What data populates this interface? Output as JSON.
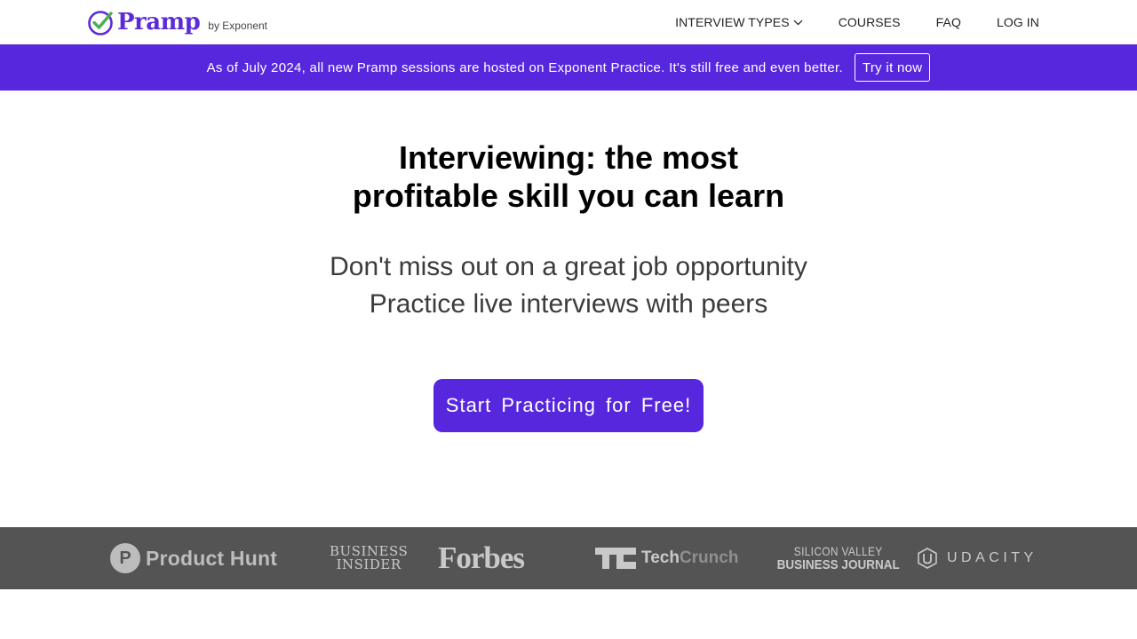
{
  "nav": {
    "logo_text": "Pramp",
    "logo_byline": "by Exponent",
    "links": [
      {
        "label": "INTERVIEW TYPES",
        "has_dropdown": true
      },
      {
        "label": "COURSES"
      },
      {
        "label": "FAQ"
      },
      {
        "label": "LOG IN"
      }
    ]
  },
  "banner": {
    "text": "As of July 2024, all new Pramp sessions are hosted on Exponent Practice. It's still free and even better.",
    "button_label": "Try it now",
    "background": "#5727dd"
  },
  "hero": {
    "title_lines": [
      "Interviewing: the most",
      "profitable skill you can learn"
    ],
    "subtitle_lines": [
      "Don't miss out on a great job opportunity",
      "Practice live interviews with peers"
    ],
    "cta_label": "Start Practicing for Free!",
    "accent": "#5727dd"
  },
  "press": {
    "background": "#545454",
    "logos": {
      "product_hunt": {
        "mark": "P",
        "text": "Product Hunt"
      },
      "business_insider": {
        "line1": "BUSINESS",
        "line2": "INSIDER"
      },
      "forbes": {
        "text": "Forbes"
      },
      "techcrunch": {
        "tech": "Tech",
        "crunch": "Crunch"
      },
      "sv_business_journal": {
        "line1": "SILICON VALLEY",
        "line2": "BUSINESS JOURNAL"
      },
      "udacity": {
        "text": "UDACITY"
      }
    }
  },
  "icons": {
    "logo": "check-circle-icon",
    "dropdown": "chevron-down-icon"
  }
}
